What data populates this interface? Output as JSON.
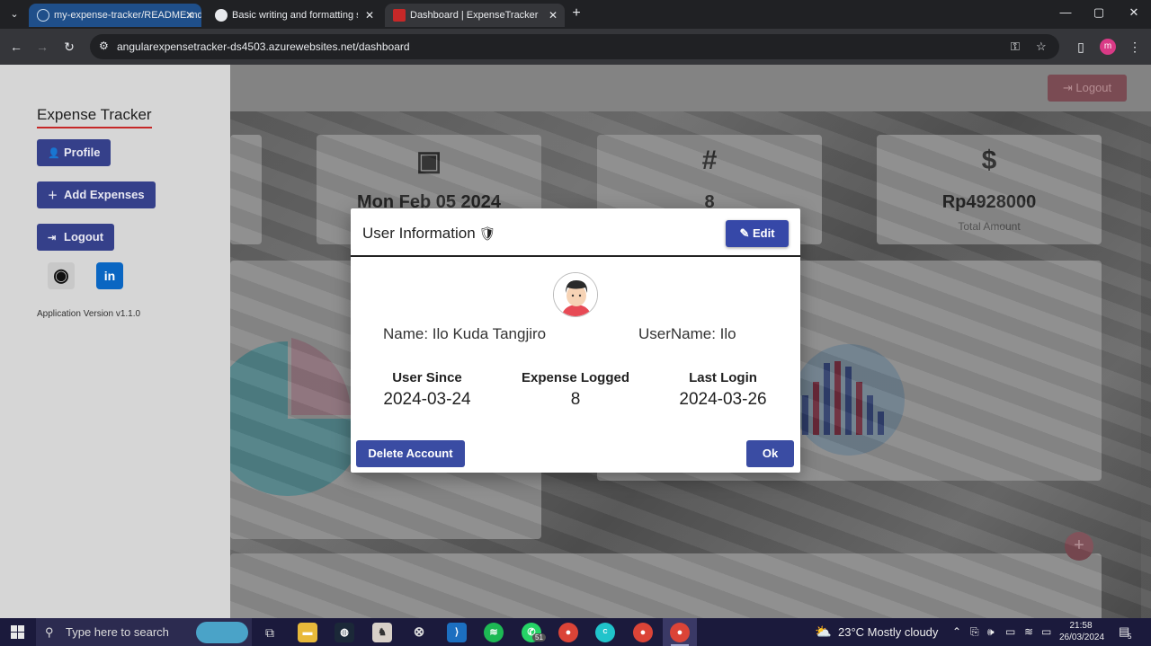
{
  "browser": {
    "tabs": [
      {
        "title": "my-expense-tracker/README.md",
        "active": false,
        "highlight": true
      },
      {
        "title": "Basic writing and formatting syntax",
        "active": false,
        "highlight": false
      },
      {
        "title": "Dashboard | ExpenseTracker",
        "active": true,
        "highlight": false
      }
    ],
    "url": "angularexpensetracker-ds4503.azurewebsites.net/dashboard",
    "profile_initial": "m"
  },
  "sidebar": {
    "brand": "Expense Tracker",
    "buttons": [
      {
        "label": "Profile",
        "icon": "person-icon"
      },
      {
        "label": "Add Expenses",
        "icon": "plus-icon"
      },
      {
        "label": "Logout",
        "icon": "logout-icon"
      }
    ],
    "social": [
      {
        "name": "github-icon",
        "glyph": "◉"
      },
      {
        "name": "linkedin-icon",
        "glyph": "in"
      }
    ],
    "version": "Application Version v1.1.0"
  },
  "header": {
    "logout_label": "Logout"
  },
  "cards": [
    {
      "icon": "calendar-icon",
      "value": "Mon Feb 05 2024",
      "label": ""
    },
    {
      "icon": "hash-icon",
      "value": "8",
      "label": ""
    },
    {
      "icon": "dollar-icon",
      "value": "Rp4928000",
      "label": "Total Amount"
    }
  ],
  "dialog": {
    "title": "User Information",
    "edit_label": "Edit",
    "name_line": "Name: Ilo Kuda Tangjiro",
    "username_line": "UserName: Ilo",
    "stats": [
      {
        "label": "User Since",
        "value": "2024-03-24"
      },
      {
        "label": "Expense Logged",
        "value": "8"
      },
      {
        "label": "Last Login",
        "value": "2024-03-26"
      }
    ],
    "delete_label": "Delete Account",
    "ok_label": "Ok"
  },
  "taskbar": {
    "search_placeholder": "Type here to search",
    "whatsapp_badge": "51",
    "weather": "23°C  Mostly cloudy",
    "time": "21:58",
    "date": "26/03/2024",
    "notifications": "5"
  }
}
